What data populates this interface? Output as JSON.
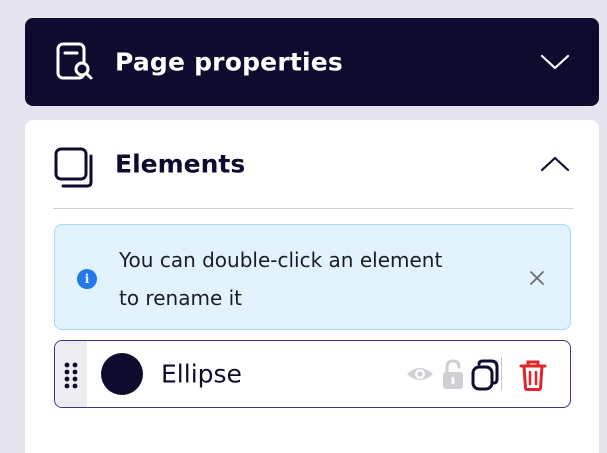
{
  "page_properties": {
    "title": "Page properties",
    "icon": "page-search-icon",
    "toggle_icon": "chevron-down-icon"
  },
  "elements": {
    "title": "Elements",
    "icon": "layers-icon",
    "toggle_icon": "chevron-up-icon",
    "info": {
      "icon": "info-icon",
      "line1": "You can double-click an element",
      "line2": "to rename it",
      "close_icon": "close-icon"
    },
    "items": [
      {
        "name": "Ellipse",
        "swatch_color": "#0d0c2e",
        "actions": [
          "eye-icon",
          "unlock-icon",
          "duplicate-icon",
          "trash-icon"
        ]
      }
    ]
  },
  "colors": {
    "header_bg": "#0d0c2e",
    "accent": "#3a3488",
    "info_bg": "#e3f3fd",
    "info_icon": "#2479ea",
    "danger": "#e0262b"
  }
}
